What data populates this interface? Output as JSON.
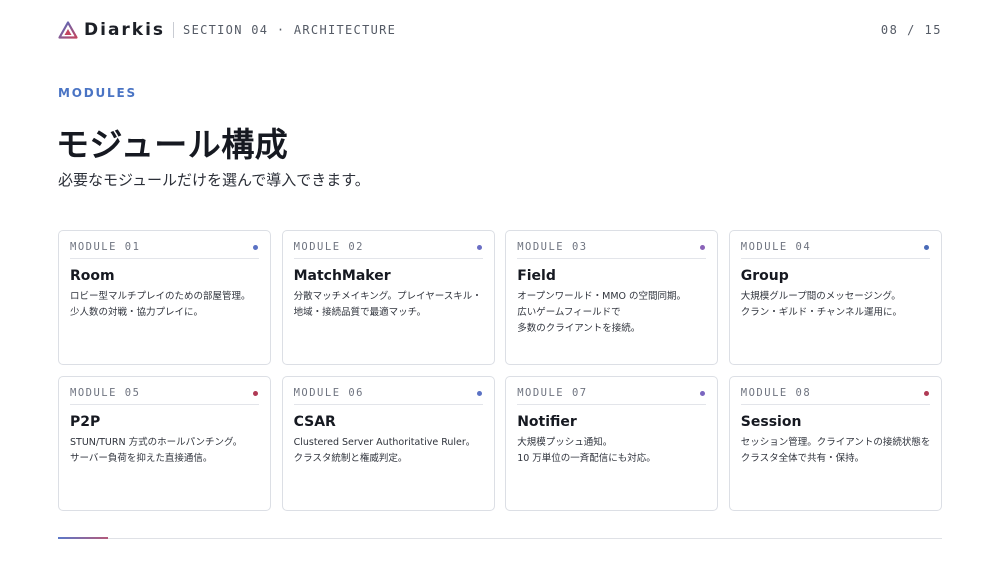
{
  "header": {
    "brand": "Diarkis",
    "section": "SECTION 04 · ARCHITECTURE",
    "page_counter": "08 / 15"
  },
  "hero": {
    "eyebrow": "MODULES",
    "title": "モジュール構成",
    "subtitle": "必要なモジュールだけを選んで導入できます。"
  },
  "colors": {
    "accent_blue": "#5b72c4",
    "accent_purple": "#8a63b8",
    "accent_red": "#b03a55"
  },
  "modules": [
    {
      "code": "MODULE 01",
      "name": "Room",
      "lines": [
        "ロビー型マルチプレイのための部屋管理。",
        "少人数の対戦・協力プレイに。"
      ],
      "dot_color": "#5b72c4"
    },
    {
      "code": "MODULE 02",
      "name": "MatchMaker",
      "lines": [
        "分散マッチメイキング。プレイヤースキル・",
        "地域・接続品質で最適マッチ。"
      ],
      "dot_color": "#6a6ec4"
    },
    {
      "code": "MODULE 03",
      "name": "Field",
      "lines": [
        "オープンワールド・MMO の空間同期。",
        "広いゲームフィールドで",
        "多数のクライアントを接続。"
      ],
      "dot_color": "#8a63b8"
    },
    {
      "code": "MODULE 04",
      "name": "Group",
      "lines": [
        "大規模グループ間のメッセージング。",
        "クラン・ギルド・チャンネル運用に。"
      ],
      "dot_color": "#4a6bb8"
    },
    {
      "code": "MODULE 05",
      "name": "P2P",
      "lines": [
        "STUN/TURN 方式のホールパンチング。",
        "サーバー負荷を抑えた直接通信。"
      ],
      "dot_color": "#b03a55"
    },
    {
      "code": "MODULE 06",
      "name": "CSAR",
      "lines": [
        "Clustered Server Authoritative Ruler。",
        "クラスタ統制と権威判定。"
      ],
      "dot_color": "#5b72c4"
    },
    {
      "code": "MODULE 07",
      "name": "Notifier",
      "lines": [
        "大規模プッシュ通知。",
        "10 万単位の一斉配信にも対応。"
      ],
      "dot_color": "#7a66c0"
    },
    {
      "code": "MODULE 08",
      "name": "Session",
      "lines": [
        "セッション管理。クライアントの接続状態を",
        "クラスタ全体で共有・保持。"
      ],
      "dot_color": "#b03a55"
    }
  ],
  "progress": {
    "fraction": 0.0567
  }
}
